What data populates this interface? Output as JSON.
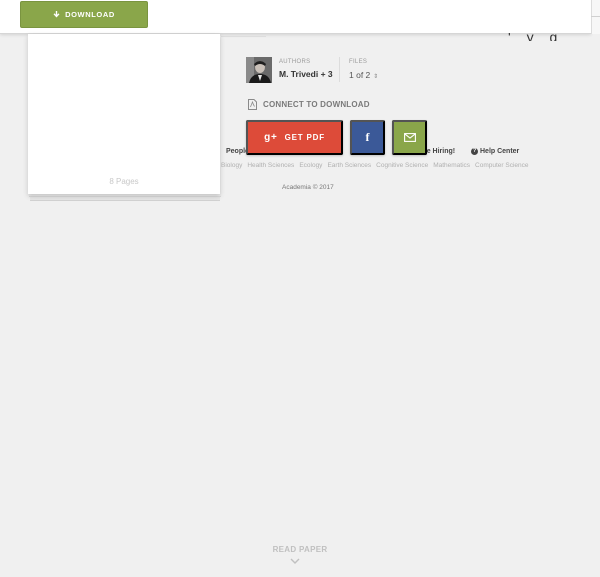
{
  "toolbar": {
    "download_label": "DOWNLOAD",
    "accent": "#8aa64a"
  },
  "paper_preview": {
    "pages_label": "8 Pages"
  },
  "authors": {
    "label": "AUTHORS",
    "value": "M. Trivedi + 3"
  },
  "files": {
    "label": "FILES",
    "value": "1 of 2"
  },
  "connect": {
    "label": "CONNECT TO DOWNLOAD"
  },
  "actions": {
    "get_pdf_label": "GET PDF",
    "gplus_glyph": "g+",
    "facebook_glyph": "f",
    "google_color": "#dd4b39",
    "facebook_color": "#3b5998",
    "email_color": "#8aa64a"
  },
  "footer": {
    "people_link": "People",
    "hiring_link": "re Hiring!",
    "help_link": "Help Center",
    "topics": [
      "Biology",
      "Health Sciences",
      "Ecology",
      "Earth Sciences",
      "Cognitive Science",
      "Mathematics",
      "Computer Science"
    ],
    "copyright": "Academia © 2017"
  },
  "read_paper": {
    "label": "READ PAPER"
  }
}
